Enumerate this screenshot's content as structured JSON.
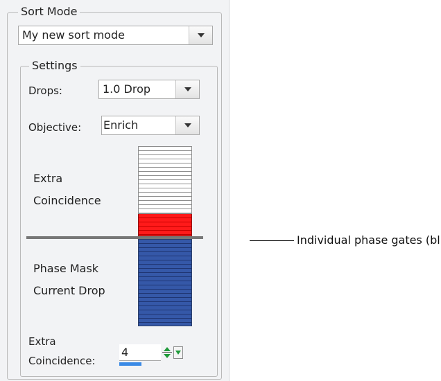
{
  "sort_mode": {
    "group_title": "Sort Mode",
    "selected": "My new sort mode"
  },
  "settings": {
    "group_title": "Settings",
    "drops_label": "Drops:",
    "drops_value": "1.0 Drop",
    "objective_label": "Objective:",
    "objective_value": "Enrich",
    "extra_coincidence_lines": [
      "Extra",
      "Coincidence"
    ],
    "phase_mask_lines": [
      "Phase Mask",
      "Current Drop"
    ],
    "extra_coincidence_field_lines": [
      "Extra",
      "Coincidence:"
    ],
    "extra_coincidence_value": "4"
  },
  "callout": {
    "text": "Individual phase gates (blue)"
  },
  "colors": {
    "extra_coincidence_gates": "#ff1a1a",
    "phase_gates": "#3558a8",
    "spinner_arrows": "#1f9a3a",
    "spinner_bar": "#3a8ae6"
  },
  "icons": {
    "combo_arrow": "chevron-down-icon",
    "spinner": "up-down-spinner-icon"
  }
}
